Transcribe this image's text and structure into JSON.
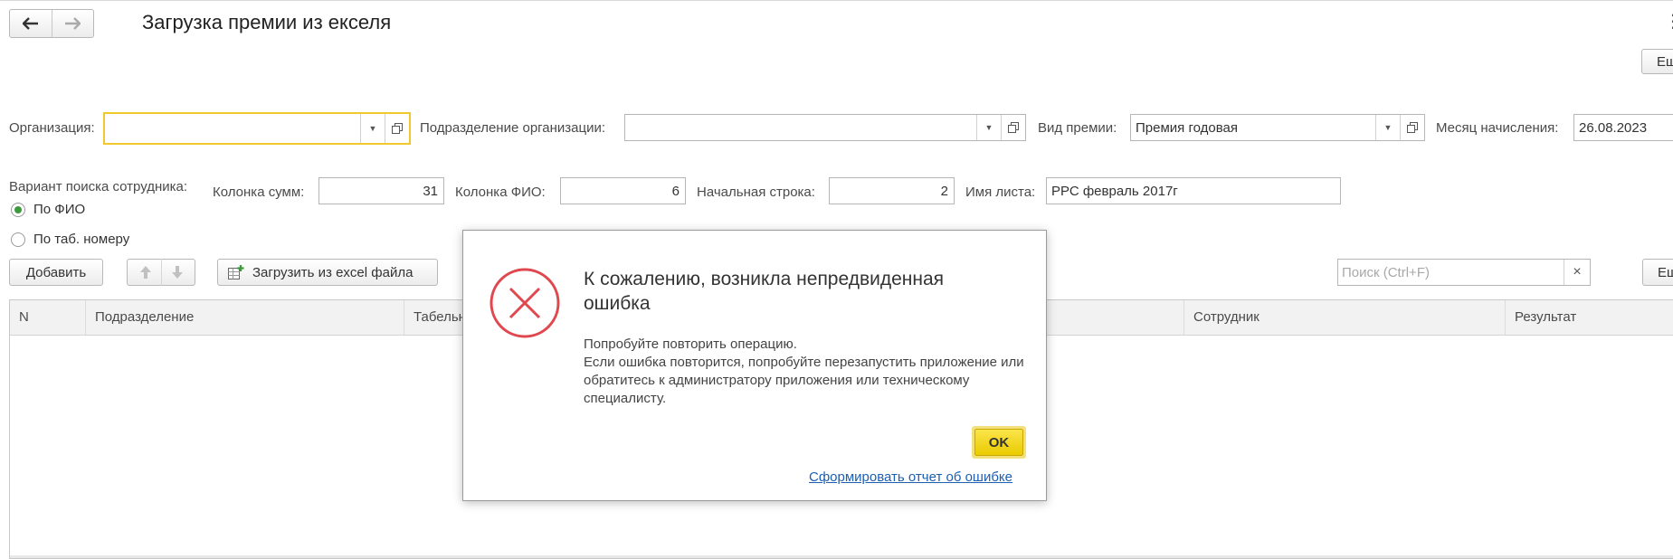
{
  "window": {
    "title": "Загрузка премии из екселя",
    "back_icon": "arrow-left-icon",
    "forward_icon": "arrow-right-icon",
    "more_icon": "vertical-dots-icon",
    "right_button_top": "Еще",
    "right_button_list": "Еще"
  },
  "filters": {
    "organization_label": "Организация:",
    "organization_value": "",
    "division_label": "Подразделение организации:",
    "division_value": "",
    "bonus_type_label": "Вид премии:",
    "bonus_type_value": "Премия годовая",
    "month_label": "Месяц начисления:",
    "month_value": "26.08.2023"
  },
  "search_options": {
    "variant_label": "Вариант поиска сотрудника:",
    "radio_fio": "По ФИО",
    "radio_tab": "По таб. номеру",
    "selected": "По ФИО",
    "sum_col_label": "Колонка сумм:",
    "sum_col_value": "31",
    "fio_col_label": "Колонка ФИО:",
    "fio_col_value": "6",
    "start_row_label": "Начальная строка:",
    "start_row_value": "2",
    "sheet_label": "Имя листа:",
    "sheet_value": "РРС февраль 2017г"
  },
  "toolbar": {
    "add_label": "Добавить",
    "up_icon": "arrow-up-icon",
    "down_icon": "arrow-down-icon",
    "load_label": "Загрузить из excel файла",
    "load_icon": "excel-add-icon",
    "search_placeholder": "Поиск (Ctrl+F)",
    "clear_label": "×"
  },
  "table": {
    "columns": [
      "N",
      "Подразделение",
      "Табельный",
      "Сотрудник",
      "Результат"
    ]
  },
  "dialog": {
    "title": "К сожалению, возникла непредвиденная ошибка",
    "body_line1": "Попробуйте повторить операцию.",
    "body_line2": "Если ошибка повторится, попробуйте перезапустить приложение или обратитесь к администратору приложения или техническому специалисту.",
    "ok_label": "OK",
    "report_link": "Сформировать отчет об ошибке",
    "icon": "error-x-circle-icon",
    "icon_color": "#e0484f"
  }
}
